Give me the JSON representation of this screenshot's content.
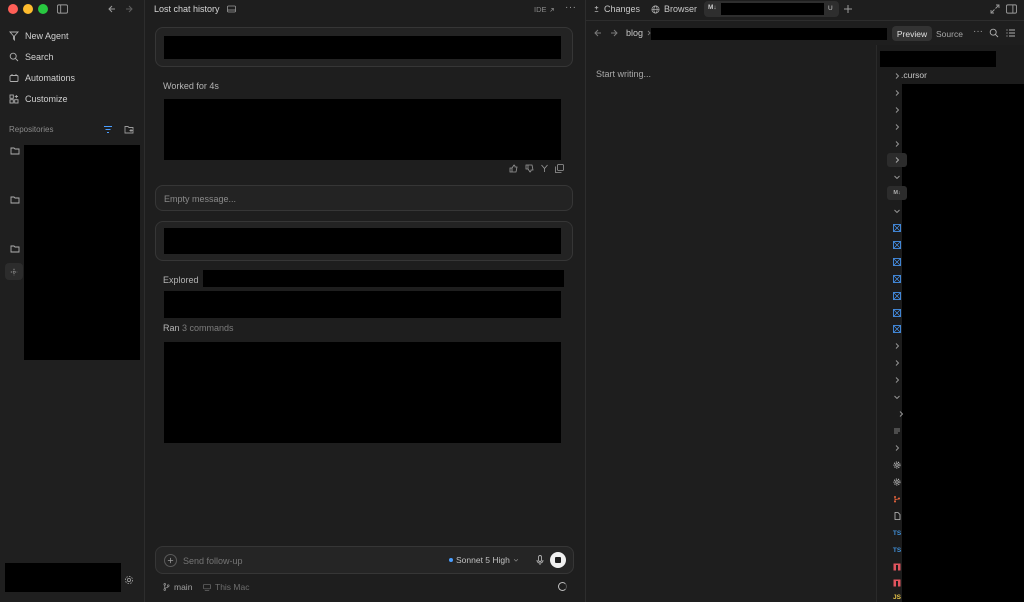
{
  "sidebar": {
    "nav": [
      {
        "label": "New Agent",
        "icon": "new-agent-icon"
      },
      {
        "label": "Search",
        "icon": "search-icon"
      },
      {
        "label": "Automations",
        "icon": "automations-icon"
      },
      {
        "label": "Customize",
        "icon": "customize-icon"
      }
    ],
    "repositories_label": "Repositories"
  },
  "chat": {
    "title": "Lost chat history",
    "ide_label": "IDE",
    "worked_label": "Worked for 4s",
    "empty_message_placeholder": "Empty message...",
    "explored_label": "Explored",
    "ran_label": "Ran",
    "ran_count": "3 commands",
    "followup_placeholder": "Send follow-up",
    "model": "Sonnet 5 High",
    "branch": "main",
    "location": "This Mac"
  },
  "right": {
    "tabs": {
      "changes": "Changes",
      "browser": "Browser",
      "file_badge": "M↓",
      "file_status": "U"
    },
    "breadcrumb": "blog",
    "preview_label": "Preview",
    "source_label": "Source",
    "editor_placeholder": "Start writing...",
    "tree_first": ".cursor",
    "file_badges": {
      "md": "M↓",
      "ts": "TS",
      "js": "JS"
    }
  },
  "colors": {
    "accent_blue": "#4a9eff",
    "close": "#ff5f57",
    "minimize": "#febc2e",
    "maximize": "#28c840",
    "ts_blue": "#3f8fd8",
    "folder_red": "#e0545e",
    "git_orange": "#e8643c",
    "js_yellow": "#e8c547"
  }
}
